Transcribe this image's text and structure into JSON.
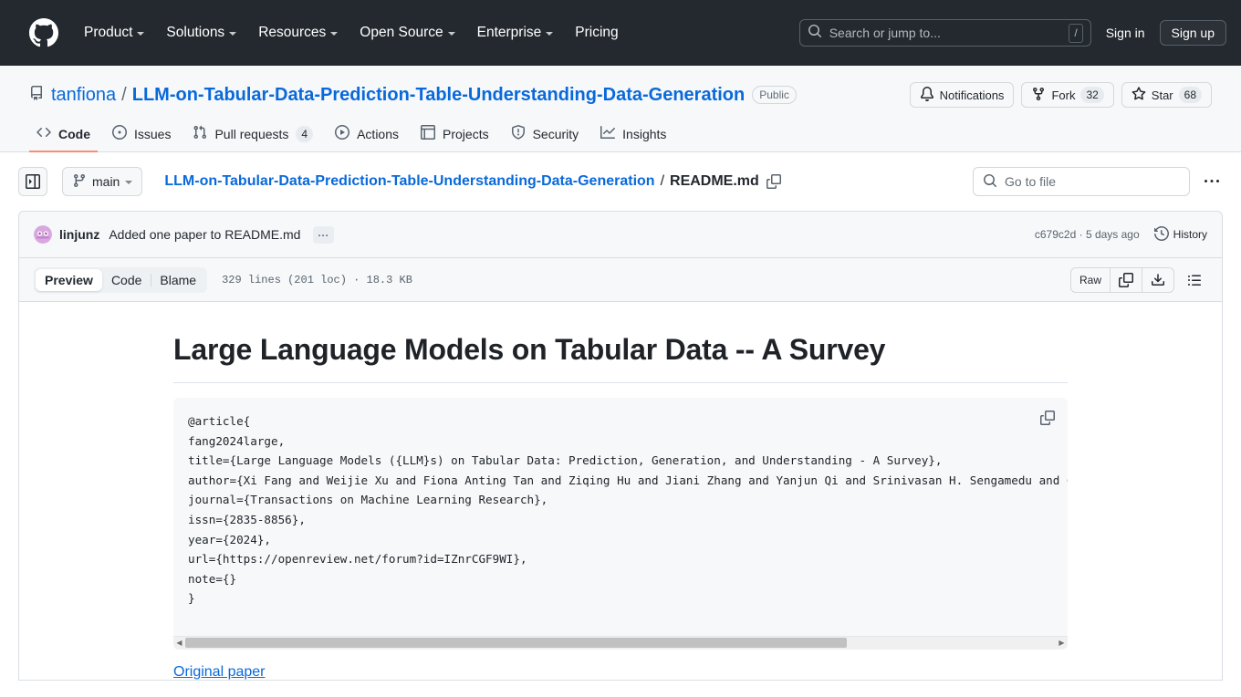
{
  "global_header": {
    "logo_icon": "github-mark-icon",
    "nav": [
      {
        "label": "Product",
        "has_caret": true
      },
      {
        "label": "Solutions",
        "has_caret": true
      },
      {
        "label": "Resources",
        "has_caret": true
      },
      {
        "label": "Open Source",
        "has_caret": true
      },
      {
        "label": "Enterprise",
        "has_caret": true
      },
      {
        "label": "Pricing",
        "has_caret": false
      }
    ],
    "search": {
      "placeholder": "Search or jump to...",
      "shortcut": "/",
      "icon": "search-icon"
    },
    "sign_in": "Sign in",
    "sign_up": "Sign up"
  },
  "repo": {
    "icon": "repo-icon",
    "owner": "tanfiona",
    "separator": "/",
    "name": "LLM-on-Tabular-Data-Prediction-Table-Understanding-Data-Generation",
    "visibility": "Public",
    "actions": {
      "notifications": {
        "label": "Notifications",
        "icon": "bell-icon"
      },
      "fork": {
        "label": "Fork",
        "count": "32",
        "icon": "fork-icon"
      },
      "star": {
        "label": "Star",
        "count": "68",
        "icon": "star-icon"
      }
    },
    "tabs": [
      {
        "label": "Code",
        "icon": "code-icon",
        "selected": true
      },
      {
        "label": "Issues",
        "icon": "issue-opened-icon",
        "selected": false
      },
      {
        "label": "Pull requests",
        "icon": "git-pull-request-icon",
        "count": "4",
        "selected": false
      },
      {
        "label": "Actions",
        "icon": "play-icon",
        "selected": false
      },
      {
        "label": "Projects",
        "icon": "table-icon",
        "selected": false
      },
      {
        "label": "Security",
        "icon": "shield-icon",
        "selected": false
      },
      {
        "label": "Insights",
        "icon": "graph-icon",
        "selected": false
      }
    ]
  },
  "file_nav": {
    "sidebar_toggle_icon": "sidebar-expand-icon",
    "branch": {
      "label": "main",
      "icon": "git-branch-icon"
    },
    "breadcrumb": {
      "repo": "LLM-on-Tabular-Data-Prediction-Table-Understanding-Data-Generation",
      "separator": "/",
      "file": "README.md",
      "copy_icon": "copy-path-icon"
    },
    "go_to_file": {
      "placeholder": "Go to file",
      "icon": "search-icon"
    },
    "more_icon": "kebab-horizontal-icon"
  },
  "commit": {
    "avatar_name": "linjunz-avatar",
    "author": "linjunz",
    "message": "Added one paper to README.md",
    "expand_label": "...",
    "sha": "c679c2d",
    "dot": "·",
    "relative_time": "5 days ago",
    "history": {
      "label": "History",
      "icon": "history-icon"
    }
  },
  "file_toolbar": {
    "views": [
      {
        "label": "Preview",
        "active": true
      },
      {
        "label": "Code",
        "active": false
      },
      {
        "label": "Blame",
        "active": false
      }
    ],
    "stats": "329 lines (201 loc) · 18.3 KB",
    "raw_label": "Raw",
    "copy_icon": "copy-icon",
    "download_icon": "download-icon",
    "outline_icon": "list-unordered-icon"
  },
  "content": {
    "heading": "Large Language Models on Tabular Data -- A Survey",
    "code_copy_icon": "copy-icon",
    "code_lines": [
      "@article{",
      "fang2024large,",
      "title={Large Language Models ({LLM}s) on Tabular Data: Prediction, Generation, and Understanding - A Survey},",
      "author={Xi Fang and Weijie Xu and Fiona Anting Tan and Ziqing Hu and Jiani Zhang and Yanjun Qi and Srinivasan H. Sengamedu and Christos Faloutsos},",
      "journal={Transactions on Machine Learning Research},",
      "issn={2835-8856},",
      "year={2024},",
      "url={https://openreview.net/forum?id=IZnrCGF9WI},",
      "note={}",
      "}"
    ],
    "scroll": {
      "left_arrow": "◀",
      "right_arrow": "▶",
      "thumb_percent": "76"
    },
    "original_paper_link": "Original paper"
  },
  "colors": {
    "header_bg": "#24292f",
    "accent_link": "#0969da",
    "tab_underline": "#fd8c73",
    "surface": "#f6f8fa",
    "border": "#d8dee4"
  }
}
